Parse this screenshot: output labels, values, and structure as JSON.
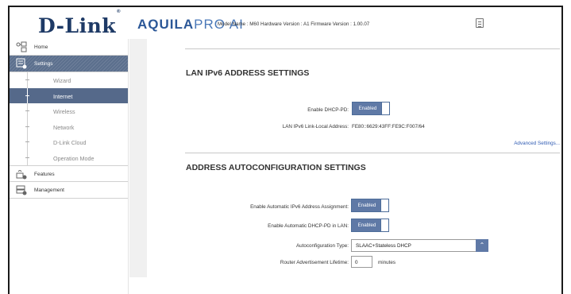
{
  "header": {
    "logo_text": "D-Link",
    "logo_mark": "®",
    "brand_bold": "AQUILA",
    "brand_light": "PRO AI",
    "model_info": "Model Name : M60 Hardware Version : A1 Firmware Version : 1.00.07",
    "notes_icon": "notes-icon"
  },
  "sidebar": {
    "home": "Home",
    "settings": "Settings",
    "sub_items": [
      "Wizard",
      "Internet",
      "Wireless",
      "Network",
      "D-Link Cloud",
      "Operation Mode"
    ],
    "features": "Features",
    "management": "Management"
  },
  "lan": {
    "title": "LAN IPv6 ADDRESS SETTINGS",
    "dhcp_pd_label": "Enable DHCP-PD:",
    "dhcp_pd_value": "Enabled",
    "link_local_label": "LAN IPv6 Link-Local Address:",
    "link_local_value": "FE80::6629:43FF:FE9C:F007/64",
    "advanced_link": "Advanced Settings..."
  },
  "autoconf": {
    "title": "ADDRESS AUTOCONFIGURATION SETTINGS",
    "auto_assign_label": "Enable Automatic IPv6 Address Assignment:",
    "auto_assign_value": "Enabled",
    "auto_dhcp_pd_label": "Enable Automatic DHCP-PD in LAN:",
    "auto_dhcp_pd_value": "Enabled",
    "type_label": "Autoconfiguration Type:",
    "type_value": "SLAAC+Stateless DHCP",
    "lifetime_label": "Router Advertisement Lifetime:",
    "lifetime_value": "0",
    "lifetime_unit": "minutes"
  },
  "colors": {
    "accent": "#5f79a6",
    "nav_selected": "#55698a",
    "link": "#2f5bb3",
    "logo": "#1e3a66"
  }
}
